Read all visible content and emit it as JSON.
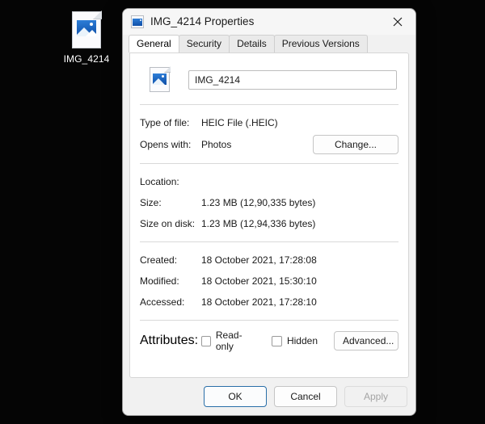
{
  "desktop": {
    "icon": {
      "name": "IMG_4214",
      "glyph": "image-file-icon"
    },
    "background_color": "#050505"
  },
  "dialog": {
    "titlebar": {
      "icon": "image-file-icon",
      "title": "IMG_4214 Properties",
      "close_label": "Close"
    },
    "tabs": [
      {
        "label": "General",
        "active": true
      },
      {
        "label": "Security",
        "active": false
      },
      {
        "label": "Details",
        "active": false
      },
      {
        "label": "Previous Versions",
        "active": false
      }
    ],
    "general": {
      "filename_value": "IMG_4214",
      "filename_placeholder": "File name",
      "rows": [
        {
          "label": "Type of file:",
          "value": "HEIC File (.HEIC)"
        },
        {
          "label": "Opens with:",
          "value": "Photos"
        },
        {
          "label": "Location:",
          "value": ""
        },
        {
          "label": "Size:",
          "value": "1.23 MB (12,90,335 bytes)"
        },
        {
          "label": "Size on disk:",
          "value": "1.23 MB (12,94,336 bytes)"
        },
        {
          "label": "Created:",
          "value": "18 October 2021, 17:28:08"
        },
        {
          "label": "Modified:",
          "value": "18 October 2021, 15:30:10"
        },
        {
          "label": "Accessed:",
          "value": "18 October 2021, 17:28:10"
        }
      ],
      "change_button": "Change...",
      "attributes_label": "Attributes:",
      "readonly_label": "Read-only",
      "readonly_checked": false,
      "hidden_label": "Hidden",
      "hidden_checked": false,
      "advanced_button": "Advanced..."
    },
    "footer": {
      "ok": "OK",
      "cancel": "Cancel",
      "apply": "Apply",
      "apply_disabled": true
    },
    "accent_color": "#2a6fa8"
  }
}
